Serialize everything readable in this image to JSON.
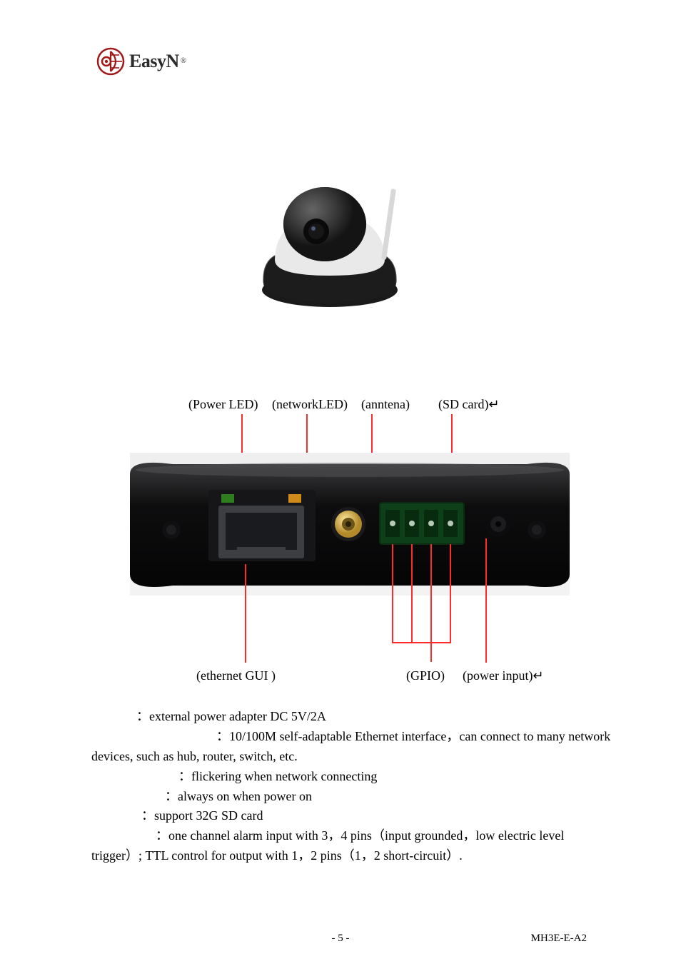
{
  "logo": {
    "text": "EasyN",
    "reg": "®"
  },
  "labels_top": {
    "power_led": "(Power LED)",
    "network_led": "(networkLED)",
    "antenna": "(anntena)",
    "sd_card": "(SD card)↵"
  },
  "labels_bottom": {
    "ethernet": "(ethernet   GUI )",
    "gpio": "(GPIO)",
    "power_input": "(power input)↵"
  },
  "body": {
    "l1": "：external power adapter   DC 5V/2A",
    "l2": "：10/100M self-adaptable Ethernet interface，can connect to many network devices, such as hub, router, switch, etc.",
    "l3": "：flickering when network connecting",
    "l4": "：always on when power on",
    "l5": "：support 32G SD card",
    "l6": "：one channel alarm input with 3，4 pins（input grounded，low electric level trigger）;   TTL control for output with 1，2 pins（1，2 short-circuit）."
  },
  "footer": {
    "page": "- 5 -",
    "doc": "MH3E-E-A2"
  }
}
